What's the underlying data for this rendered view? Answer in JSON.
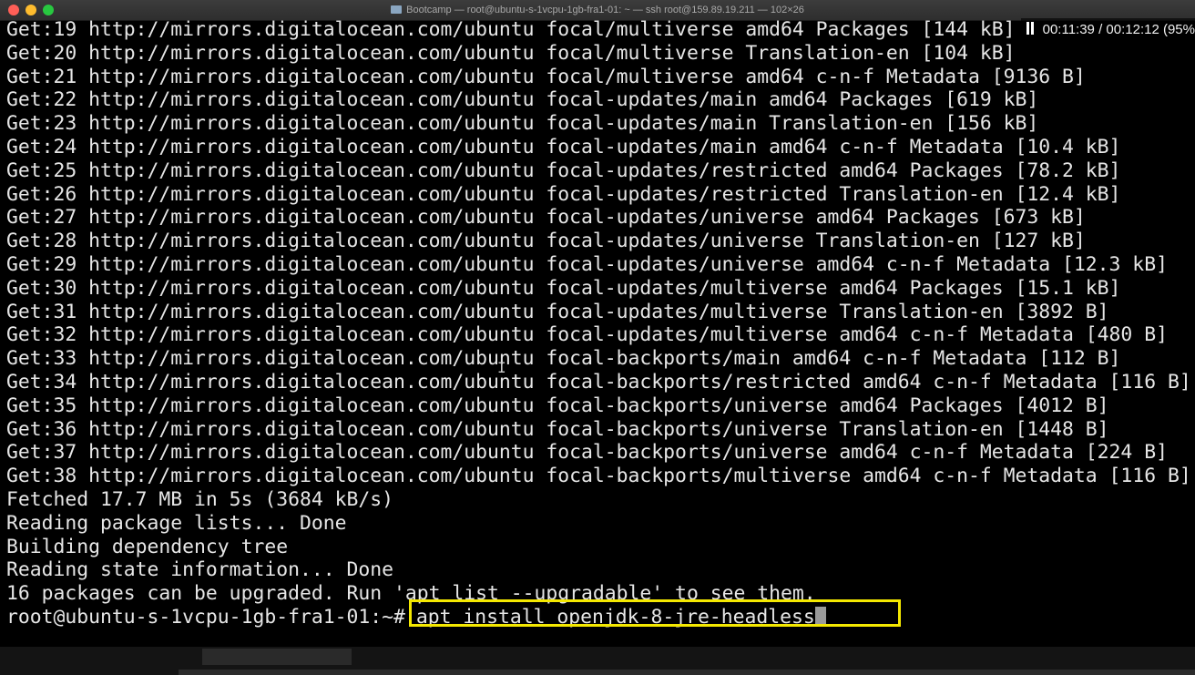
{
  "window": {
    "title": "Bootcamp — root@ubuntu-s-1vcpu-1gb-fra1-01: ~ — ssh root@159.89.19.211 — 102×26"
  },
  "overlay": {
    "elapsed": "00:11:39",
    "separator": "/",
    "total": "00:12:12",
    "percent": "(95%"
  },
  "terminal": {
    "lines": [
      "Get:19 http://mirrors.digitalocean.com/ubuntu focal/multiverse amd64 Packages [144 kB]",
      "Get:20 http://mirrors.digitalocean.com/ubuntu focal/multiverse Translation-en [104 kB]",
      "Get:21 http://mirrors.digitalocean.com/ubuntu focal/multiverse amd64 c-n-f Metadata [9136 B]",
      "Get:22 http://mirrors.digitalocean.com/ubuntu focal-updates/main amd64 Packages [619 kB]",
      "Get:23 http://mirrors.digitalocean.com/ubuntu focal-updates/main Translation-en [156 kB]",
      "Get:24 http://mirrors.digitalocean.com/ubuntu focal-updates/main amd64 c-n-f Metadata [10.4 kB]",
      "Get:25 http://mirrors.digitalocean.com/ubuntu focal-updates/restricted amd64 Packages [78.2 kB]",
      "Get:26 http://mirrors.digitalocean.com/ubuntu focal-updates/restricted Translation-en [12.4 kB]",
      "Get:27 http://mirrors.digitalocean.com/ubuntu focal-updates/universe amd64 Packages [673 kB]",
      "Get:28 http://mirrors.digitalocean.com/ubuntu focal-updates/universe Translation-en [127 kB]",
      "Get:29 http://mirrors.digitalocean.com/ubuntu focal-updates/universe amd64 c-n-f Metadata [12.3 kB]",
      "Get:30 http://mirrors.digitalocean.com/ubuntu focal-updates/multiverse amd64 Packages [15.1 kB]",
      "Get:31 http://mirrors.digitalocean.com/ubuntu focal-updates/multiverse Translation-en [3892 B]",
      "Get:32 http://mirrors.digitalocean.com/ubuntu focal-updates/multiverse amd64 c-n-f Metadata [480 B]",
      "Get:33 http://mirrors.digitalocean.com/ubuntu focal-backports/main amd64 c-n-f Metadata [112 B]",
      "Get:34 http://mirrors.digitalocean.com/ubuntu focal-backports/restricted amd64 c-n-f Metadata [116 B]",
      "Get:35 http://mirrors.digitalocean.com/ubuntu focal-backports/universe amd64 Packages [4012 B]",
      "Get:36 http://mirrors.digitalocean.com/ubuntu focal-backports/universe Translation-en [1448 B]",
      "Get:37 http://mirrors.digitalocean.com/ubuntu focal-backports/universe amd64 c-n-f Metadata [224 B]",
      "Get:38 http://mirrors.digitalocean.com/ubuntu focal-backports/multiverse amd64 c-n-f Metadata [116 B]",
      "Fetched 17.7 MB in 5s (3684 kB/s)",
      "Reading package lists... Done",
      "Building dependency tree",
      "Reading state information... Done",
      "16 packages can be upgraded. Run 'apt list --upgradable' to see them."
    ],
    "prompt": "root@ubuntu-s-1vcpu-1gb-fra1-01:~#",
    "command": "apt install openjdk-8-jre-headless"
  },
  "colors": {
    "highlight": "#f4e800",
    "text": "#e6e6e6",
    "background": "#000000"
  },
  "icons": {
    "close": "close-icon",
    "minimize": "minimize-icon",
    "maximize": "maximize-icon",
    "folder": "folder-icon",
    "pause": "pause-icon",
    "text_cursor": "text-cursor-icon"
  }
}
